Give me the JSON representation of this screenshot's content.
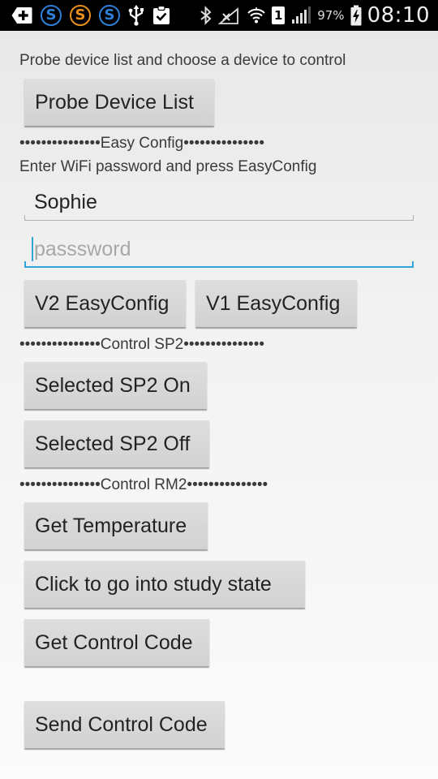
{
  "status_bar": {
    "left_icons": [
      "add-box-icon",
      "s-blue-icon",
      "s-orange-icon",
      "s-blue-icon",
      "usb-icon",
      "clipboard-check-icon"
    ],
    "right_icons": [
      "bluetooth-icon",
      "no-signal-icon",
      "wifi-icon",
      "sim-1-icon",
      "cell-signal-icon",
      "battery-charging-icon"
    ],
    "sim_slot": "1",
    "battery_percent": "97%",
    "time": "08:10"
  },
  "probe": {
    "instruction": "Probe device list and choose a device to control",
    "button_label": "Probe Device List"
  },
  "easy_config": {
    "section_title": "•••••••••••••••Easy Config•••••••••••••••",
    "instruction": "Enter WiFi password and press EasyConfig",
    "ssid_value": "Sophie",
    "password_placeholder": "passsword",
    "password_value": "",
    "v2_button_label": "V2 EasyConfig",
    "v1_button_label": "V1 EasyConfig"
  },
  "control_sp2": {
    "section_title": "•••••••••••••••Control SP2•••••••••••••••",
    "on_button_label": "Selected SP2 On",
    "off_button_label": "Selected SP2 Off"
  },
  "control_rm2": {
    "section_title": "•••••••••••••••Control RM2•••••••••••••••",
    "temperature_button_label": "Get Temperature",
    "study_button_label": "Click to go into study state",
    "get_code_button_label": "Get Control Code",
    "send_code_button_label": "Send Control Code"
  }
}
